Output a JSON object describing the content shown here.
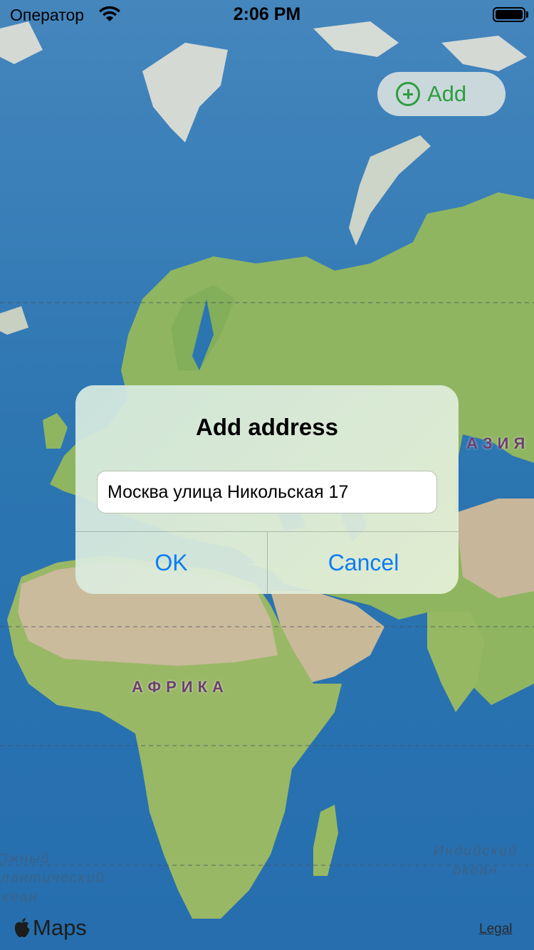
{
  "status_bar": {
    "carrier": "Оператор",
    "time": "2:06 PM",
    "wifi_icon": "wifi-icon",
    "battery_icon": "battery-icon"
  },
  "add_button": {
    "label": "Add",
    "icon": "plus-circle-icon",
    "color": "#2d9e3c"
  },
  "map": {
    "labels": {
      "asia": "АЗИЯ",
      "africa": "АФРИКА",
      "south_atlantic": [
        "Южный",
        "Атлантический",
        "океан"
      ],
      "indian_ocean": [
        "Индийский",
        "океан"
      ]
    },
    "colors": {
      "ocean": "#2f7fc1",
      "land": "#9cc56a",
      "desert": "#d9c9a7"
    }
  },
  "dialog": {
    "title": "Add address",
    "input_value": "Москва улица Никольская 17",
    "ok_label": "OK",
    "cancel_label": "Cancel",
    "button_color": "#0b7cf4"
  },
  "footer": {
    "maps_label": "Maps",
    "maps_icon": "apple-logo-icon",
    "legal_label": "Legal"
  }
}
